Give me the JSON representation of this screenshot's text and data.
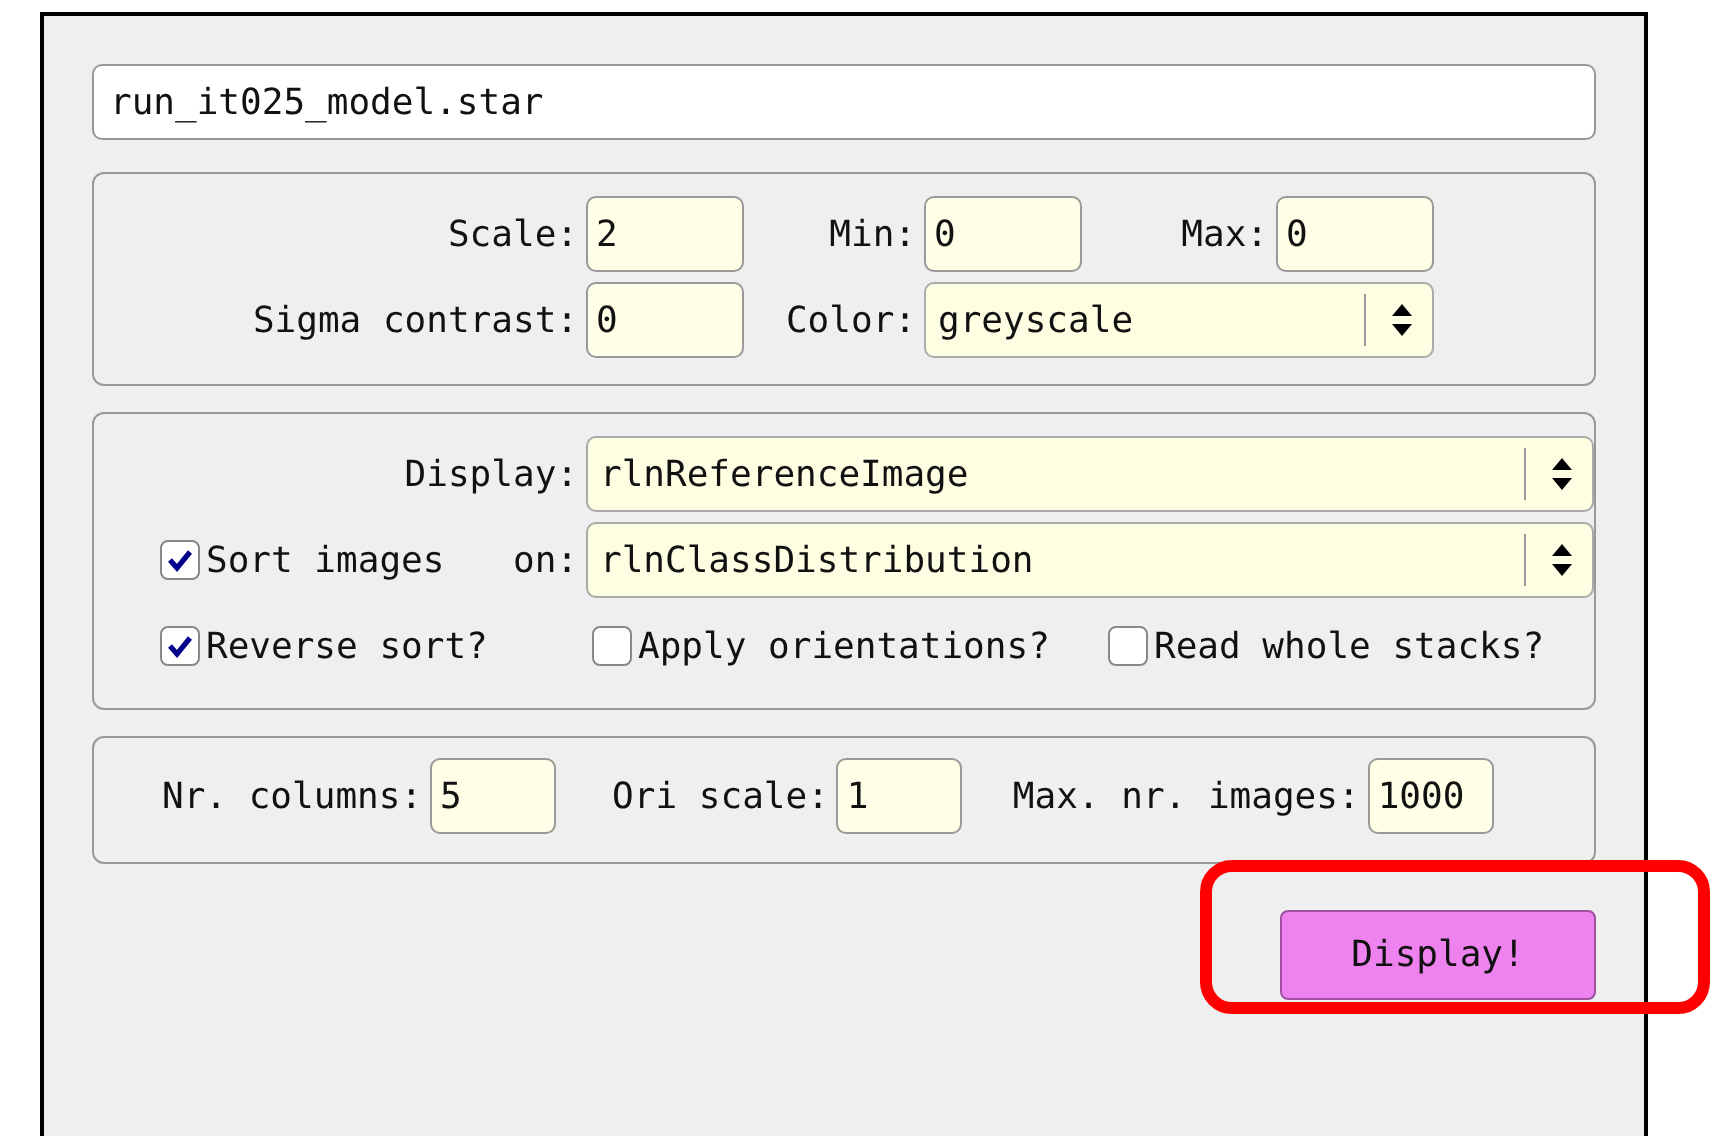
{
  "file_field": {
    "value": "run_it025_model.star"
  },
  "scale_panel": {
    "scale": {
      "label": "Scale:",
      "value": "2"
    },
    "min": {
      "label": "Min:",
      "value": "0"
    },
    "max": {
      "label": "Max:",
      "value": "0"
    },
    "sigma": {
      "label": "Sigma contrast:",
      "value": "0"
    },
    "color": {
      "label": "Color:",
      "value": "greyscale"
    }
  },
  "display_panel": {
    "display": {
      "label": "Display:",
      "value": "rlnReferenceImage"
    },
    "sort": {
      "checked": true,
      "label": "Sort images",
      "on_label": "on:",
      "value": "rlnClassDistribution"
    },
    "options": [
      {
        "label": "Reverse sort?",
        "checked": true
      },
      {
        "label": "Apply orientations?",
        "checked": false
      },
      {
        "label": "Read whole stacks?",
        "checked": false
      }
    ]
  },
  "layout_panel": {
    "fields": [
      {
        "label": "Nr. columns:",
        "value": "5"
      },
      {
        "label": "Ori scale:",
        "value": "1"
      },
      {
        "label": "Max. nr. images:",
        "value": "1000"
      }
    ]
  },
  "display_button": {
    "label": "Display!",
    "highlighted": true
  }
}
